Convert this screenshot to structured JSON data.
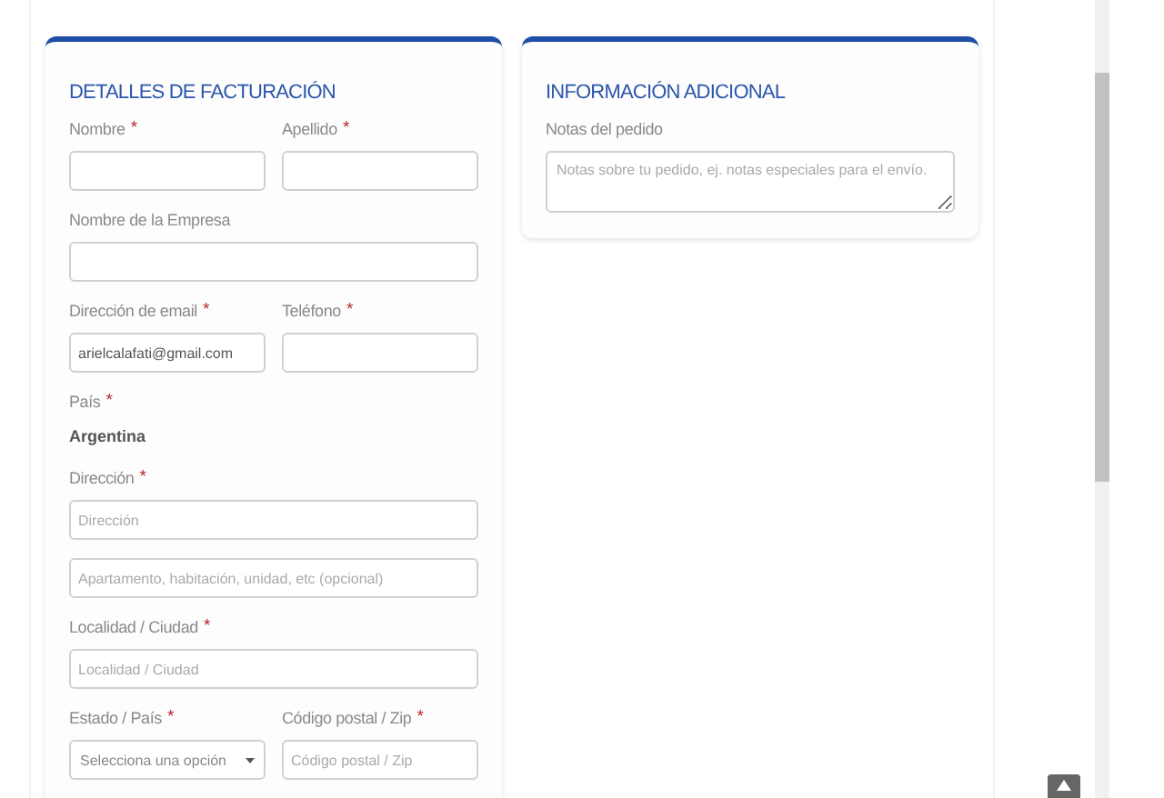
{
  "billing": {
    "title": "DETALLES DE FACTURACIÓN",
    "rows": [
      [
        {
          "kind": "input",
          "label": "Nombre",
          "mark": "*"
        },
        {
          "kind": "input",
          "label": "Apellido",
          "mark": "*"
        }
      ],
      [
        {
          "kind": "input",
          "label": "Nombre de la Empresa"
        }
      ],
      [
        {
          "kind": "input",
          "label": "Dirección de email",
          "mark": "*",
          "value": "arielcalafati@gmail.com"
        },
        {
          "kind": "input",
          "label": "Teléfono",
          "mark": "*"
        }
      ],
      [
        {
          "kind": "static",
          "label": "País",
          "mark": "*",
          "value": "Argentina"
        }
      ],
      [
        {
          "kind": "input",
          "label": "Dirección",
          "mark": "*",
          "placeholder": "Dirección"
        }
      ],
      [
        {
          "kind": "input",
          "placeholder": "Apartamento, habitación, unidad, etc (opcional)"
        }
      ],
      [
        {
          "kind": "input",
          "label": "Localidad / Ciudad",
          "mark": "*",
          "placeholder": "Localidad / Ciudad"
        }
      ],
      [
        {
          "kind": "select",
          "label": "Estado / País",
          "mark": "*",
          "value": "Selecciona una opción"
        },
        {
          "kind": "input",
          "label": "Código postal / Zip",
          "mark": "*",
          "placeholder": "Código postal / Zip"
        }
      ]
    ]
  },
  "additional": {
    "title": "INFORMACIÓN ADICIONAL",
    "rows": [
      [
        {
          "kind": "textarea",
          "label": "Notas del pedido",
          "placeholder": "Notas sobre tu pedido, ej. notas especiales para el envío."
        }
      ]
    ]
  }
}
